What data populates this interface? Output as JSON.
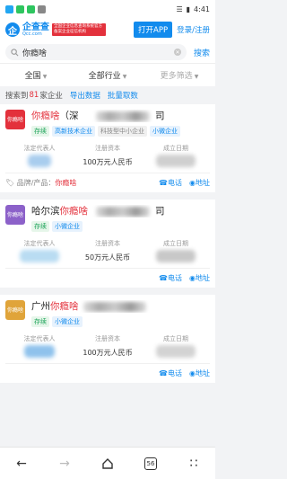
{
  "statusbar": {
    "time": "4:41",
    "battery": "▮"
  },
  "header": {
    "logo_char": "企",
    "brand_name": "企查查",
    "brand_domain": "Qcc.com",
    "badge_text": "全国企业信息查询系统官方备案企业征信机构",
    "open_app": "打开APP",
    "login": "登录/注册"
  },
  "search": {
    "value": "你瘾啥",
    "button": "搜索"
  },
  "filters": [
    {
      "label": "全国"
    },
    {
      "label": "全部行业"
    },
    {
      "label": "更多筛选"
    }
  ],
  "result": {
    "prefix": "搜索到",
    "count": "81",
    "suffix": "家企业",
    "export": "导出数据",
    "batch": "批量取数"
  },
  "labels": {
    "rep": "法定代表人",
    "capital": "注册资本",
    "date": "成立日期",
    "phone": "电话",
    "address": "地址",
    "product_label": "品牌/产品："
  },
  "cards": [
    {
      "logo": "你瘾啥",
      "logo_color": "#e3313c",
      "title_pre": "",
      "title_hl": "你瘾啥",
      "title_post": "（深",
      "title_end": "司",
      "tags": [
        "存续",
        "高新技术企业",
        "科技型中小企业",
        "小微企业"
      ],
      "capital": "100万元人民币",
      "product": "你瘾啥"
    },
    {
      "logo": "你瘾啥",
      "logo_color": "#8c61c9",
      "title_pre": "哈尔滨",
      "title_hl": "你瘾啥",
      "title_post": "",
      "title_end": "司",
      "tags": [
        "存续",
        "小微企业"
      ],
      "capital": "50万元人民币",
      "product": ""
    },
    {
      "logo": "你瘾啥",
      "logo_color": "#e0a43a",
      "title_pre": "广州",
      "title_hl": "你瘾啥",
      "title_post": "",
      "title_end": "",
      "tags": [
        "存续",
        "小微企业"
      ],
      "capital": "100万元人民币",
      "product": ""
    }
  ],
  "navbar": {
    "tabs_count": "56"
  }
}
